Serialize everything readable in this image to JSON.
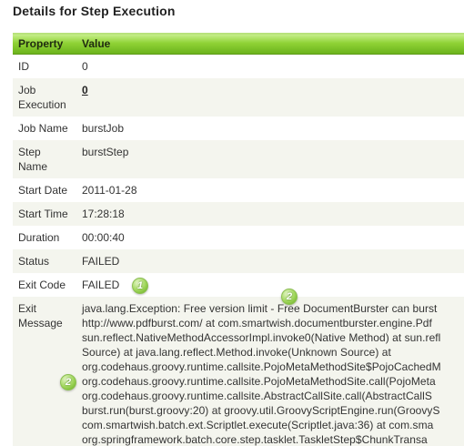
{
  "page": {
    "title": "Details for Step Execution"
  },
  "table": {
    "headers": {
      "property": "Property",
      "value": "Value"
    },
    "rows": {
      "id": {
        "label": "ID",
        "value": "0"
      },
      "job_exec": {
        "label": "Job Execution",
        "value": "0"
      },
      "job_name": {
        "label": "Job Name",
        "value": "burstJob"
      },
      "step_name": {
        "label": "Step Name",
        "value": "burstStep"
      },
      "start_date": {
        "label": "Start Date",
        "value": "2011-01-28"
      },
      "start_time": {
        "label": "Start Time",
        "value": "17:28:18"
      },
      "duration": {
        "label": "Duration",
        "value": "00:00:40"
      },
      "status": {
        "label": "Status",
        "value": "FAILED"
      },
      "exit_code": {
        "label": "Exit Code",
        "value": "FAILED"
      },
      "exit_msg": {
        "label": "Exit Message",
        "lines": [
          "java.lang.Exception: Free version limit - Free DocumentBurster can burst",
          "http://www.pdfburst.com/ at com.smartwish.documentburster.engine.Pdf",
          "sun.reflect.NativeMethodAccessorImpl.invoke0(Native Method) at sun.refl",
          "Source) at java.lang.reflect.Method.invoke(Unknown Source) at",
          "org.codehaus.groovy.runtime.callsite.PojoMetaMethodSite$PojoCachedM",
          "org.codehaus.groovy.runtime.callsite.PojoMetaMethodSite.call(PojoMeta",
          "org.codehaus.groovy.runtime.callsite.AbstractCallSite.call(AbstractCallS",
          "burst.run(burst.groovy:20) at groovy.util.GroovyScriptEngine.run(GroovyS",
          "com.smartwish.batch.ext.Scriptlet.execute(Scriptlet.java:36) at com.sma",
          "org.springframework.batch.core.step.tasklet.TaskletStep$ChunkTransa"
        ]
      }
    }
  },
  "badges": {
    "one": "1",
    "two_a": "2",
    "two_b": "2"
  },
  "colors": {
    "header_green": "#8fd235",
    "row_alt": "#f4f5ee"
  }
}
